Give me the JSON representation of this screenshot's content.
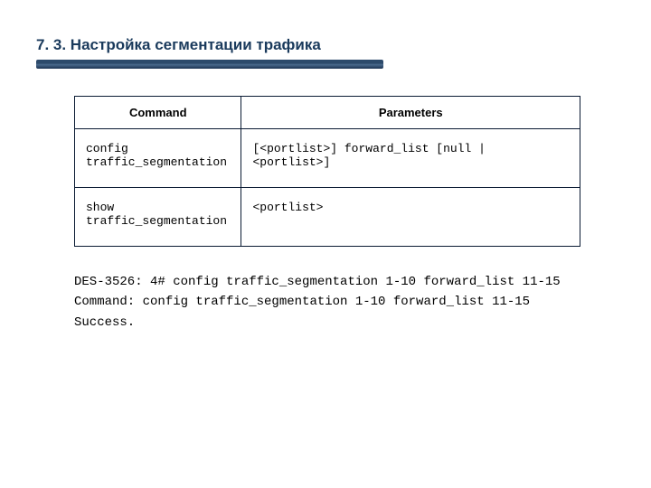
{
  "heading": "7. 3. Настройка сегментации трафика",
  "table": {
    "headers": {
      "command": "Command",
      "parameters": "Parameters"
    },
    "rows": [
      {
        "command": "config\ntraffic_segmentation",
        "parameters": "[<portlist>] forward_list [null | <portlist>]"
      },
      {
        "command": "show\ntraffic_segmentation",
        "parameters": "<portlist>"
      }
    ]
  },
  "terminal": {
    "line1": "DES-3526: 4# config traffic_segmentation 1-10 forward_list 11-15",
    "line2": "Command: config traffic_segmentation 1-10 forward_list 11-15",
    "blank": "",
    "line3": "Success."
  }
}
